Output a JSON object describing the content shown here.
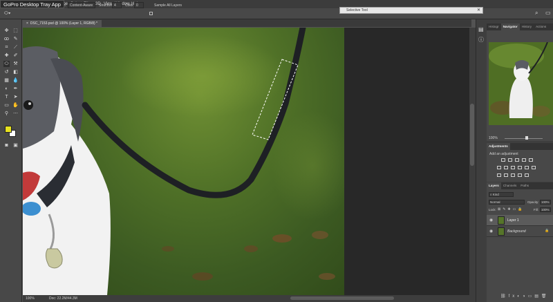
{
  "tray_tooltip": "GoPro Desktop Tray App",
  "menu": [
    "ayer",
    "Type",
    "Select",
    "Filter",
    "3D",
    "View",
    "Window",
    "Help"
  ],
  "options": {
    "fetch_label": "Fetch:",
    "fetch_value": "Content-Aware",
    "structure_label": "Structure:",
    "structure_value": "4",
    "color_label": "Color:",
    "color_value": "0",
    "sample_all_layers": "Sample All Layers"
  },
  "selective_tool_title": "Selective Tool",
  "document_tab": "DSC_7153.psd @ 100% (Layer 1, RGB/8) *",
  "status": {
    "zoom": "100%",
    "doc": "Doc: 22.2M/44.3M"
  },
  "panels": {
    "top_tabs": [
      "Histogr",
      "Navigator",
      "History",
      "Actions"
    ],
    "navigator_zoom": "100%",
    "adjustments": {
      "title": "Adjustments",
      "add_label": "Add an adjustment"
    },
    "layer_tabs": [
      "Layers",
      "Channels",
      "Paths"
    ],
    "kind_label": "Kind",
    "blend_mode": "Normal",
    "opacity_label": "Opacity:",
    "opacity_value": "100%",
    "lock_label": "Lock:",
    "fill_label": "Fill:",
    "fill_value": "100%",
    "layers": [
      {
        "name": "Layer 1"
      },
      {
        "name": "Background"
      }
    ]
  },
  "colors": {
    "foreground": "#e7e21f",
    "background": "#ffffff"
  }
}
